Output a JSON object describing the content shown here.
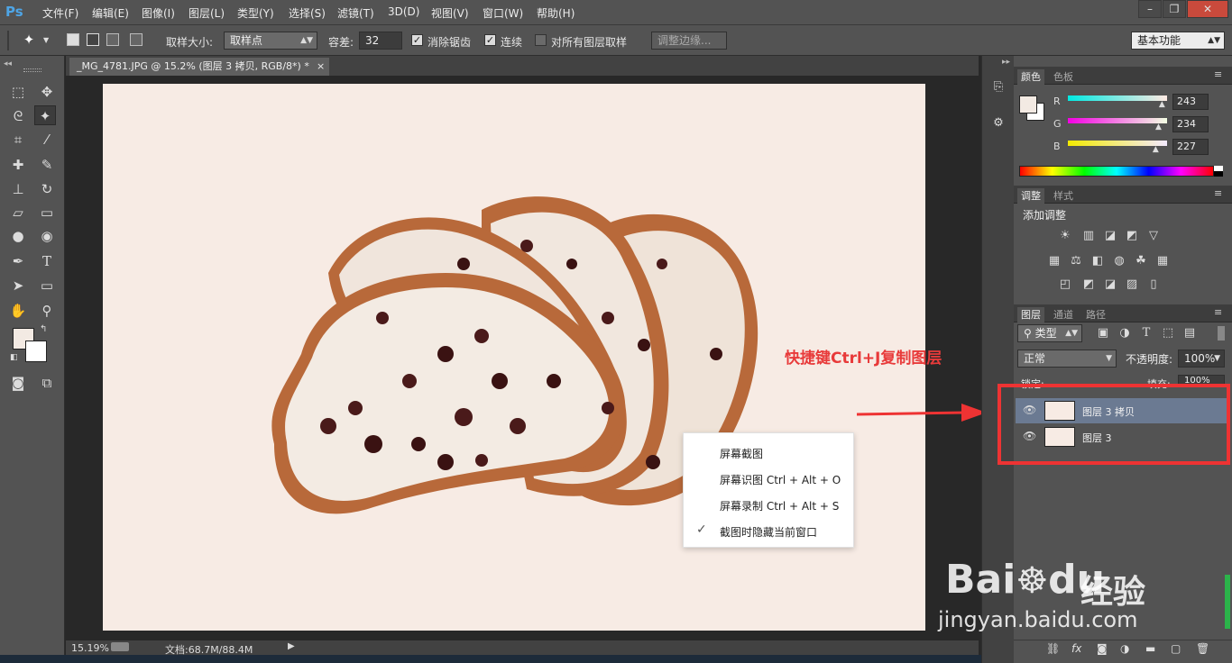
{
  "app": {
    "logo": "Ps"
  },
  "menu": [
    "文件(F)",
    "编辑(E)",
    "图像(I)",
    "图层(L)",
    "类型(Y)",
    "选择(S)",
    "滤镜(T)",
    "3D(D)",
    "视图(V)",
    "窗口(W)",
    "帮助(H)"
  ],
  "window_controls": {
    "minimize": "–",
    "restore": "❐",
    "close": "✕"
  },
  "options": {
    "sample_size_label": "取样大小:",
    "sample_size_value": "取样点",
    "tolerance_label": "容差:",
    "tolerance_value": "32",
    "antialias_label": "消除锯齿",
    "contiguous_label": "连续",
    "sample_all_label": "对所有图层取样",
    "refine_edge_label": "调整边缘...",
    "workspace_value": "基本功能"
  },
  "document": {
    "tab_title": "_MG_4781.JPG @ 15.2% (图层 3 拷贝, RGB/8*) *",
    "tab_close": "×",
    "zoom": "15.19%",
    "doc_size": "文档:68.7M/88.4M"
  },
  "context_menu": {
    "items": [
      {
        "label": "屏幕截图",
        "checked": false
      },
      {
        "label": "屏幕识图 Ctrl + Alt + O",
        "checked": false
      },
      {
        "label": "屏幕录制 Ctrl + Alt + S",
        "checked": false
      },
      {
        "label": "截图时隐藏当前窗口",
        "checked": true
      }
    ],
    "check_mark": "✓"
  },
  "annotation": {
    "text": "快捷键Ctrl+J复制图层",
    "color": "#e83a3a"
  },
  "color_panel": {
    "tabs": [
      "颜色",
      "色板"
    ],
    "channels": [
      {
        "label": "R",
        "value": "243",
        "fraction": 0.953
      },
      {
        "label": "G",
        "value": "234",
        "fraction": 0.918
      },
      {
        "label": "B",
        "value": "227",
        "fraction": 0.89
      }
    ],
    "foreground": "#f3eae3",
    "background": "#ffffff"
  },
  "adjustments_panel": {
    "tabs": [
      "调整",
      "样式"
    ],
    "title": "添加调整"
  },
  "layers_panel": {
    "tabs": [
      "图层",
      "通道",
      "路径"
    ],
    "filter_value": "类型",
    "blend_mode": "正常",
    "opacity_label": "不透明度:",
    "opacity_value": "100%",
    "lock_label": "锁定:",
    "fill_label": "填充:",
    "fill_value": "100%",
    "layers": [
      {
        "name": "图层 3 拷贝",
        "selected": true
      },
      {
        "name": "图层 3",
        "selected": false
      }
    ],
    "footer_icons": [
      "link-icon",
      "fx-icon",
      "mask-icon",
      "adjustment-icon",
      "folder-icon",
      "new-layer-icon",
      "trash-icon"
    ],
    "fx_label": "fx"
  },
  "watermark": {
    "brand": "Bai",
    "brand_du": "du",
    "cn": "经验",
    "url": "jingyan.baidu.com"
  }
}
